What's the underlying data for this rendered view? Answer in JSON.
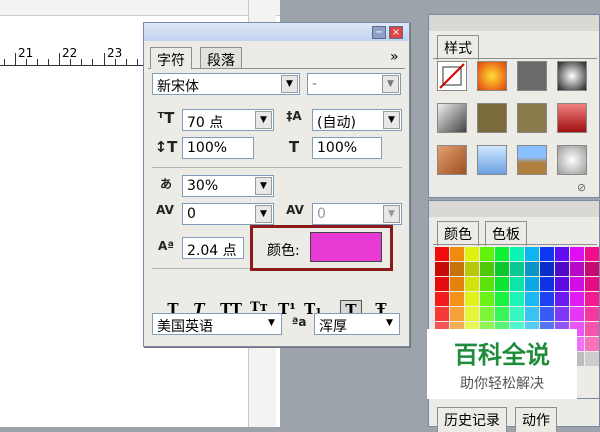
{
  "ruler": {
    "labels": [
      "21",
      "22",
      "23"
    ]
  },
  "panel": {
    "tabs": [
      "字符",
      "段落"
    ],
    "font_family": "新宋体",
    "font_style": "-",
    "font_size": "70 点",
    "leading": "(自动)",
    "vertical_scale": "100%",
    "horizontal_scale": "100%",
    "tsume": "30%",
    "kerning": "0",
    "tracking": "0",
    "baseline_shift": "2.04 点",
    "color_label": "颜色:",
    "color_value": "#e83ad4",
    "language": "美国英语",
    "anti_alias": "浑厚",
    "menu_glyph": "»",
    "style_buttons": [
      "T",
      "T",
      "TT",
      "Tт",
      "T¹",
      "T₁",
      "T",
      "Ŧ"
    ]
  },
  "styles_panel": {
    "tab": "样式"
  },
  "swatches_panel": {
    "tabs": [
      "颜色",
      "色板"
    ]
  },
  "history_panel": {
    "tabs": [
      "历史记录",
      "动作"
    ]
  },
  "watermark": {
    "title": "百科全说",
    "subtitle": "助你轻松解决"
  }
}
